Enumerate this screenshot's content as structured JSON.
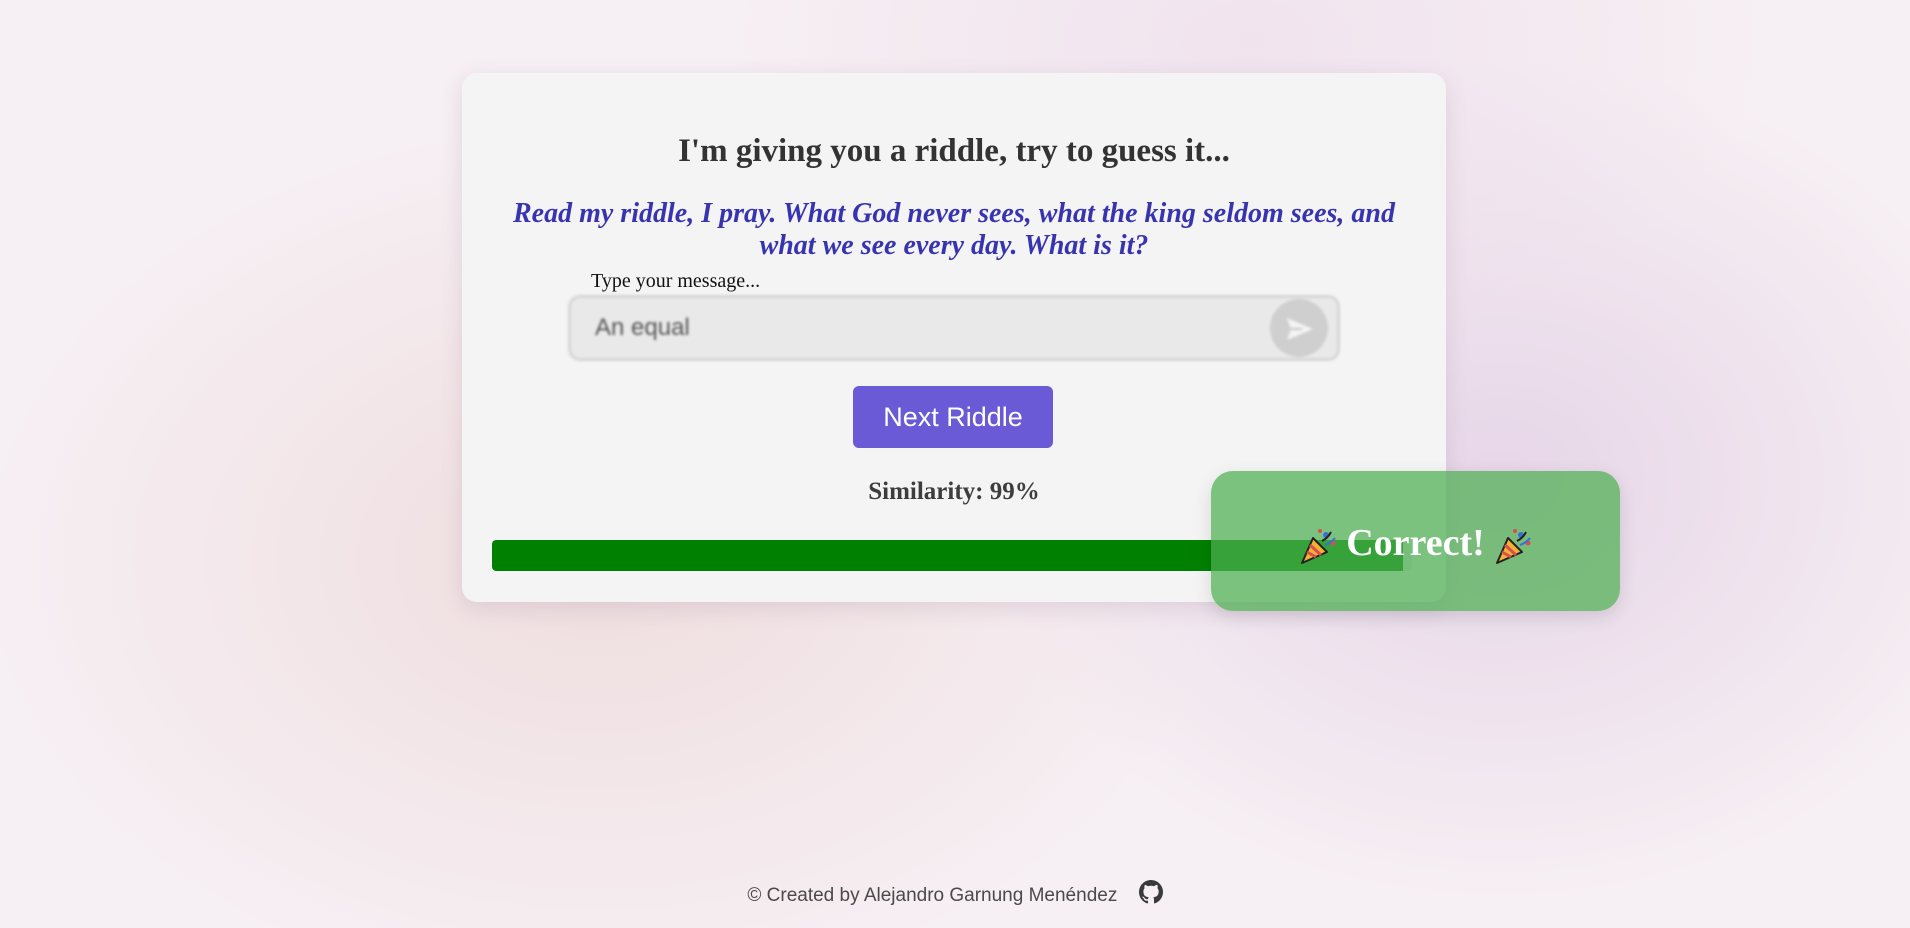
{
  "card": {
    "heading": "I'm giving you a riddle, try to guess it...",
    "riddle": "Read my riddle, I pray. What God never sees, what the king seldom sees, and what we see every day. What is it?",
    "input_label": "Type your message...",
    "input_value": "An equal",
    "send_icon": "send-icon",
    "next_button_label": "Next Riddle",
    "similarity_text": "Similarity: 99%",
    "progress_percent": 99,
    "accent_color": "#6a5ad5",
    "riddle_color": "#3834b0",
    "progress_color": "#008000"
  },
  "overlay": {
    "text": "Correct!",
    "icon": "party-popper-icon",
    "color": "#4caf50"
  },
  "footer": {
    "text": "© Created by Alejandro Garnung Menéndez",
    "icon": "github-icon"
  }
}
